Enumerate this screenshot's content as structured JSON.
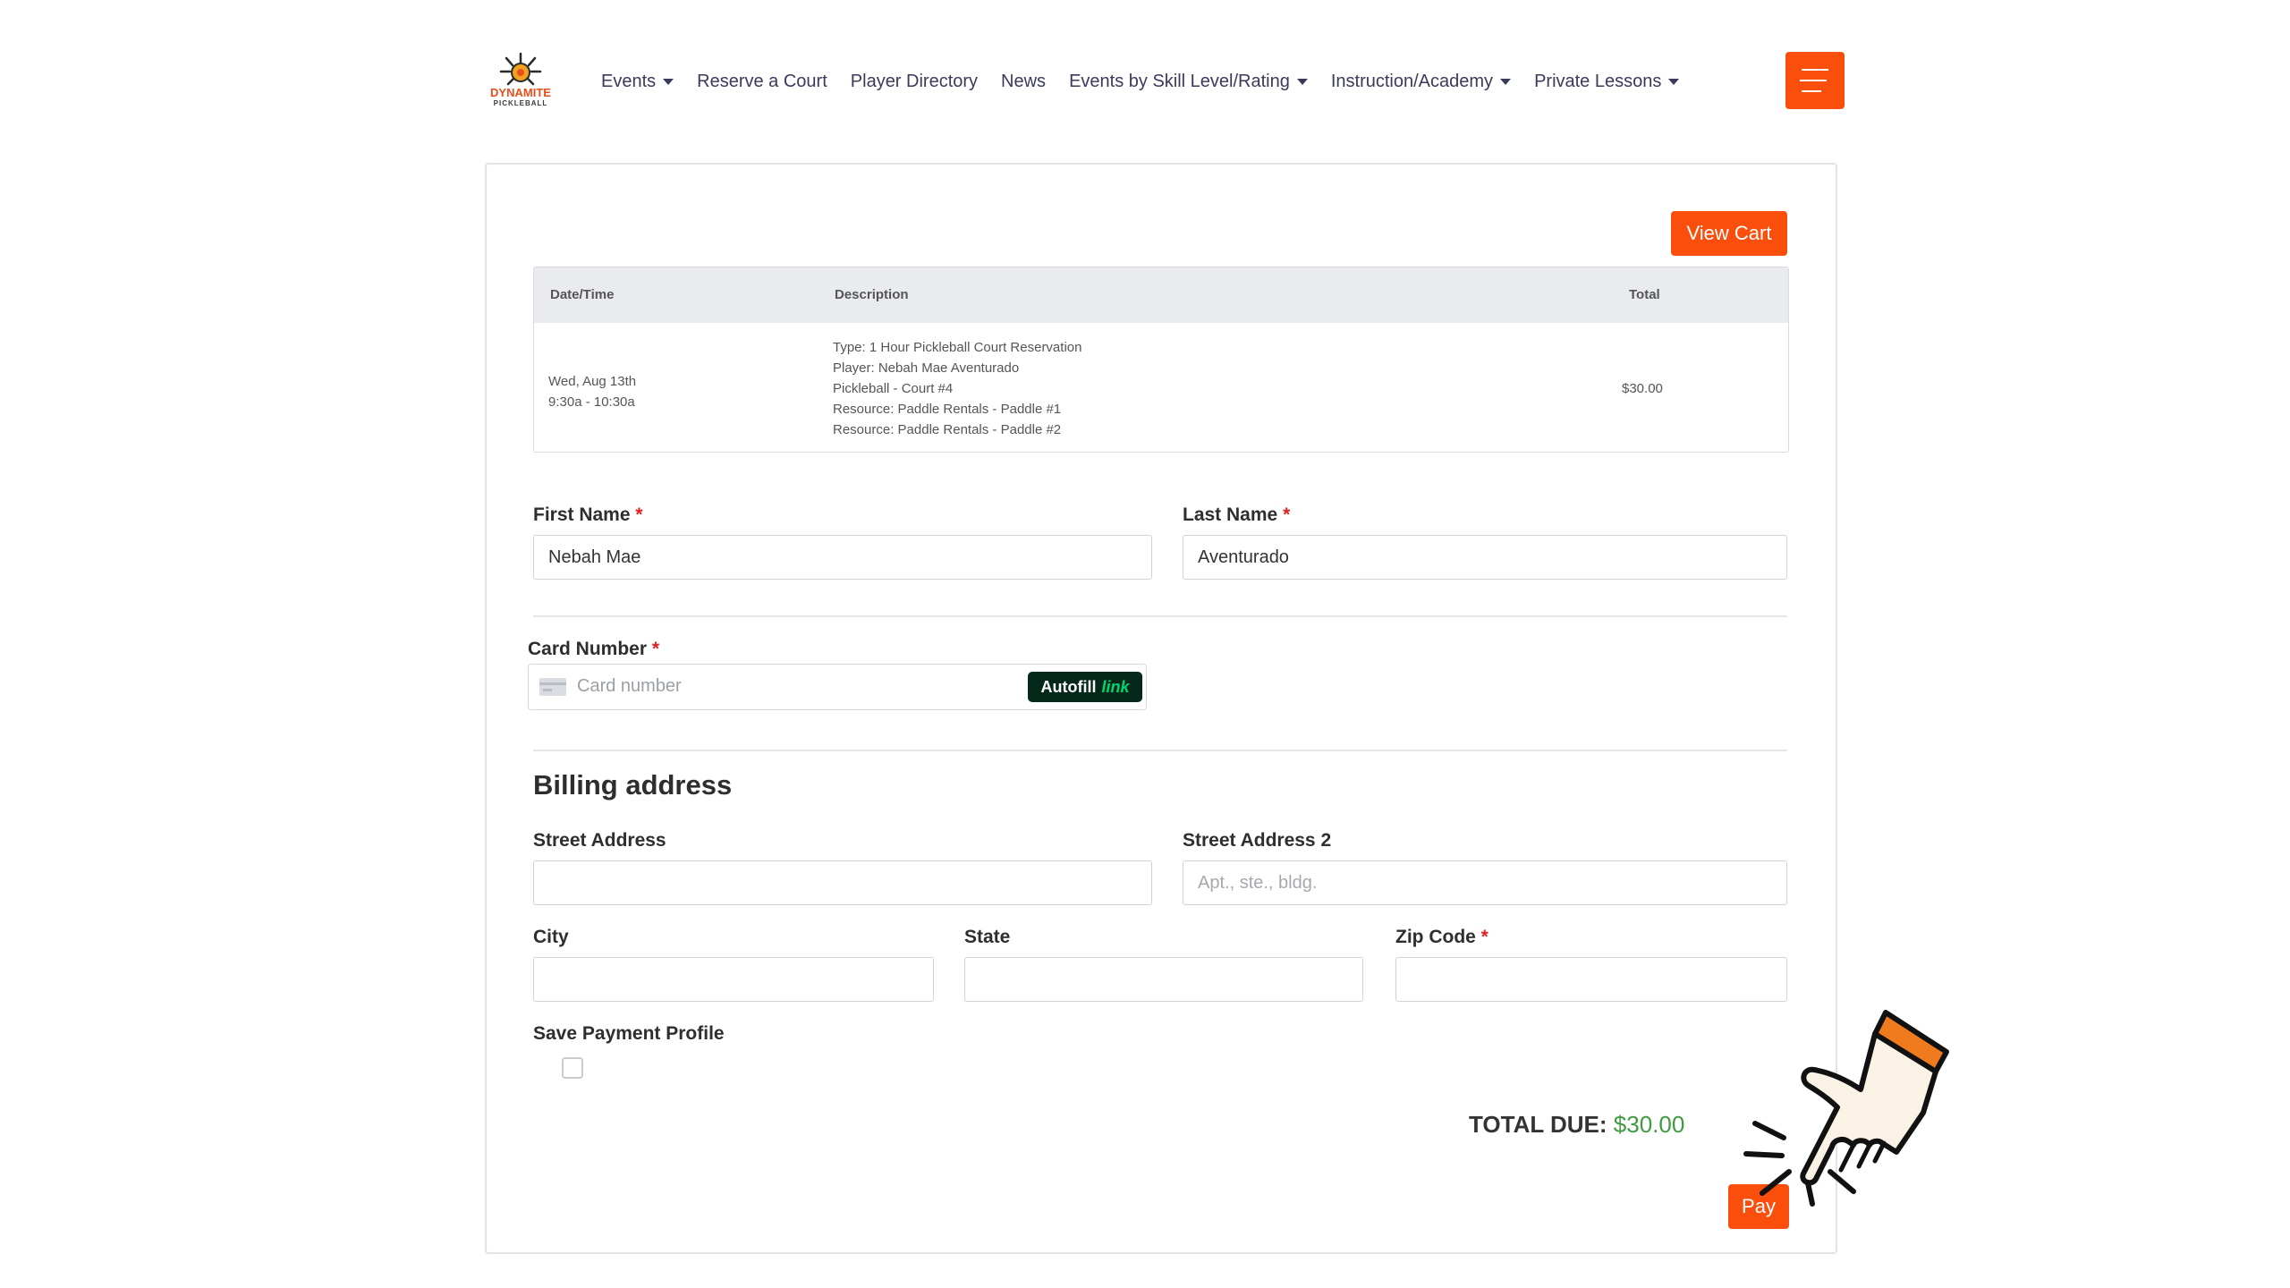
{
  "logo": {
    "text": "DYNAMITE",
    "sub": "PICKLEBALL"
  },
  "nav": [
    {
      "label": "Events",
      "dropdown": true
    },
    {
      "label": "Reserve a Court",
      "dropdown": false
    },
    {
      "label": "Player Directory",
      "dropdown": false
    },
    {
      "label": "News",
      "dropdown": false
    },
    {
      "label": "Events by Skill Level/Rating",
      "dropdown": true
    },
    {
      "label": "Instruction/Academy",
      "dropdown": true
    },
    {
      "label": "Private Lessons",
      "dropdown": true
    }
  ],
  "cart": {
    "view_cart_label": "View Cart",
    "headers": {
      "datetime": "Date/Time",
      "description": "Description",
      "total": "Total"
    },
    "row": {
      "date": "Wed, Aug 13th",
      "time": "9:30a - 10:30a",
      "description": [
        "Type: 1 Hour Pickleball Court Reservation",
        "Player: Nebah Mae Aventurado",
        "Pickleball - Court #4",
        "Resource: Paddle Rentals - Paddle #1",
        "Resource: Paddle Rentals - Paddle #2"
      ],
      "total": "$30.00"
    }
  },
  "form": {
    "first_name": {
      "label": "First Name",
      "value": "Nebah Mae"
    },
    "last_name": {
      "label": "Last Name",
      "value": "Aventurado"
    },
    "card_number": {
      "label": "Card Number",
      "placeholder": "Card number",
      "autofill": "Autofill",
      "autofill_link": "link"
    },
    "billing_title": "Billing address",
    "street": {
      "label": "Street Address",
      "value": ""
    },
    "street2": {
      "label": "Street Address 2",
      "placeholder": "Apt., ste., bldg."
    },
    "city": {
      "label": "City"
    },
    "state": {
      "label": "State"
    },
    "zip": {
      "label": "Zip Code"
    },
    "save_profile": {
      "label": "Save Payment Profile"
    },
    "required_mark": "*"
  },
  "summary": {
    "total_label": "TOTAL DUE:",
    "total_amount": "$30.00",
    "pay_label": "Pay"
  },
  "colors": {
    "accent": "#fa4e0c",
    "total_green": "#3f9b3f",
    "required_red": "#e02020"
  }
}
